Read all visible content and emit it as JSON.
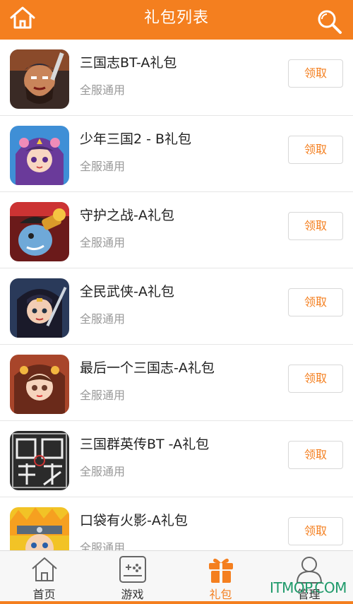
{
  "header": {
    "title": "礼包列表"
  },
  "gifts": [
    {
      "name": "三国志BT-A礼包",
      "scope": "全服通用",
      "button": "领取"
    },
    {
      "name": "少年三国2 - B礼包",
      "scope": "全服通用",
      "button": "领取"
    },
    {
      "name": "守护之战-A礼包",
      "scope": "全服通用",
      "button": "领取"
    },
    {
      "name": "全民武侠-A礼包",
      "scope": "全服通用",
      "button": "领取"
    },
    {
      "name": "最后一个三国志-A礼包",
      "scope": "全服通用",
      "button": "领取"
    },
    {
      "name": "三国群英传BT -A礼包",
      "scope": "全服通用",
      "button": "领取"
    },
    {
      "name": "口袋有火影-A礼包",
      "scope": "全服通用",
      "button": "领取"
    }
  ],
  "tabbar": {
    "tabs": [
      {
        "label": "首页",
        "icon": "home-icon"
      },
      {
        "label": "游戏",
        "icon": "gamepad-icon"
      },
      {
        "label": "礼包",
        "icon": "gift-icon",
        "active": true
      },
      {
        "label": "管理",
        "icon": "user-icon"
      }
    ]
  },
  "watermark": "ITMOP.COM",
  "colors": {
    "accent": "#f47f1f",
    "watermark": "#1e9a6a"
  }
}
